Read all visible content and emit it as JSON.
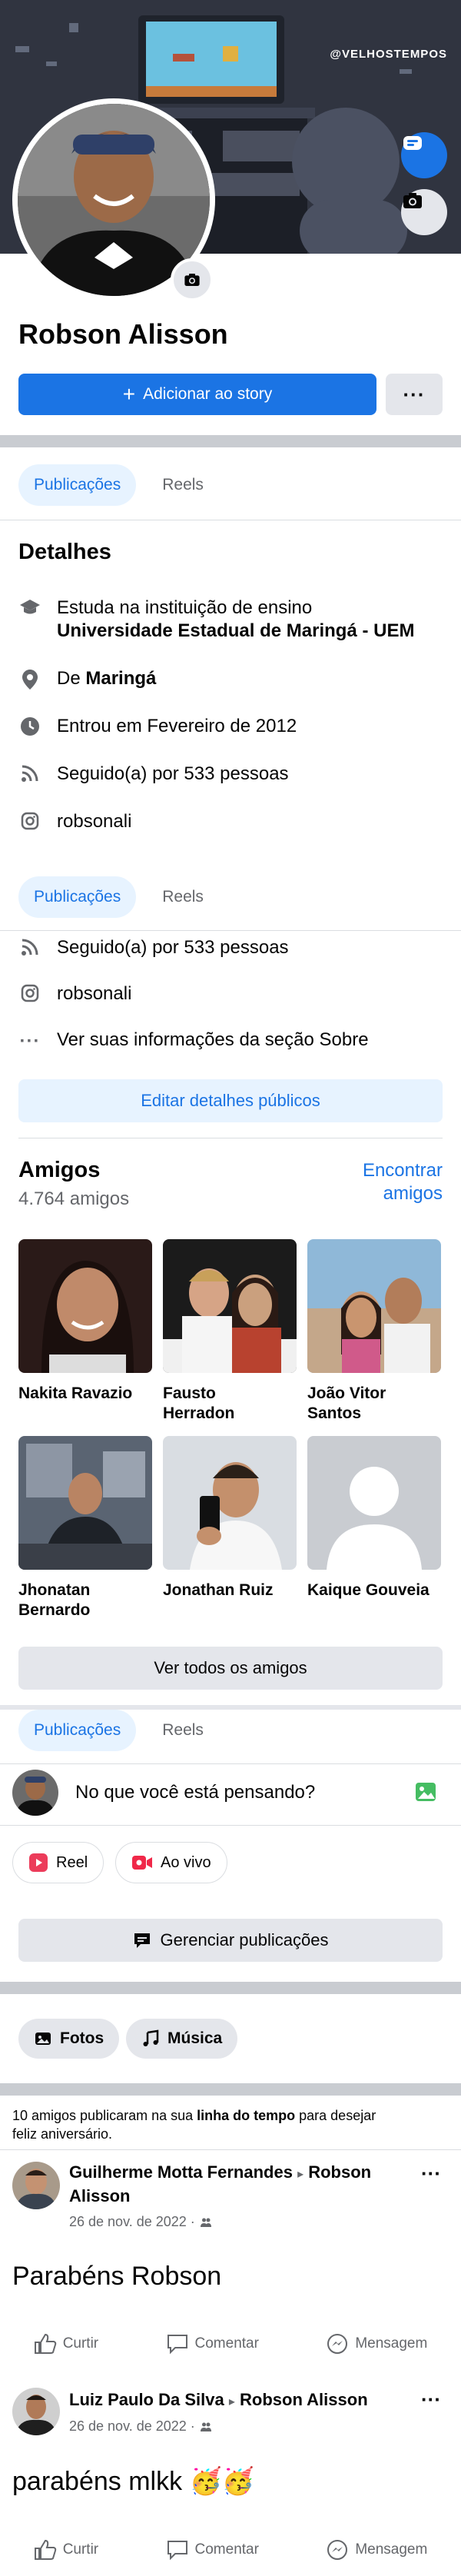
{
  "cover": {
    "handle": "@VELHOSTEMPOS"
  },
  "profile": {
    "name": "Robson Alisson",
    "add_story_label": "Adicionar ao story",
    "more_label": "···"
  },
  "tabs": {
    "posts": "Publicações",
    "reels": "Reels"
  },
  "details": {
    "title": "Detalhes",
    "study_prefix": "Estuda na instituição de ensino",
    "study_place": "Universidade Estadual de Maringá - UEM",
    "from_prefix": "De",
    "from_place": "Maringá",
    "joined": "Entrou em Fevereiro de 2012",
    "followed": "Seguido(a) por 533 pessoas",
    "instagram": "robsonali",
    "about": "Ver suas informações da seção Sobre",
    "edit_label": "Editar detalhes públicos"
  },
  "friends": {
    "title": "Amigos",
    "count": "4.764 amigos",
    "find_label_1": "Encontrar",
    "find_label_2": "amigos",
    "list": [
      {
        "name_1": "Nakita Ravazio",
        "name_2": ""
      },
      {
        "name_1": "Fausto",
        "name_2": "Herradon"
      },
      {
        "name_1": "João Vitor",
        "name_2": "Santos"
      },
      {
        "name_1": "Jhonatan",
        "name_2": "Bernardo"
      },
      {
        "name_1": "Jonathan Ruiz",
        "name_2": ""
      },
      {
        "name_1": "Kaique Gouveia",
        "name_2": ""
      }
    ],
    "see_all_label": "Ver todos os amigos"
  },
  "composer": {
    "placeholder": "No que você está pensando?",
    "reel_label": "Reel",
    "live_label": "Ao vivo",
    "manage_label": "Gerenciar publicações"
  },
  "chips": {
    "photos": "Fotos",
    "music": "Música"
  },
  "birthday": {
    "part1": "10 amigos publicaram na sua ",
    "bold": "linha do tempo",
    "part2": " para desejar",
    "line2": "feliz aniversário."
  },
  "posts": [
    {
      "author": "Guilherme Motta Fernandes",
      "arrow": "▸",
      "target": "Robson",
      "target_2": "Alisson",
      "date": "26 de nov. de 2022 ·",
      "text": "Parabéns Robson"
    },
    {
      "author": "Luiz Paulo Da Silva",
      "arrow": "▸",
      "target": "Robson Alisson",
      "target_2": "",
      "date": "26 de nov. de 2022 ·",
      "text": "parabéns mlkk 🥳🥳"
    }
  ],
  "actions": {
    "like": "Curtir",
    "comment": "Comentar",
    "message": "Mensagem"
  },
  "colors": {
    "accent": "#1b74e4",
    "accent_bg": "#e7f3ff",
    "grey_btn": "#e4e6eb",
    "separator": "#c9ccd1"
  }
}
